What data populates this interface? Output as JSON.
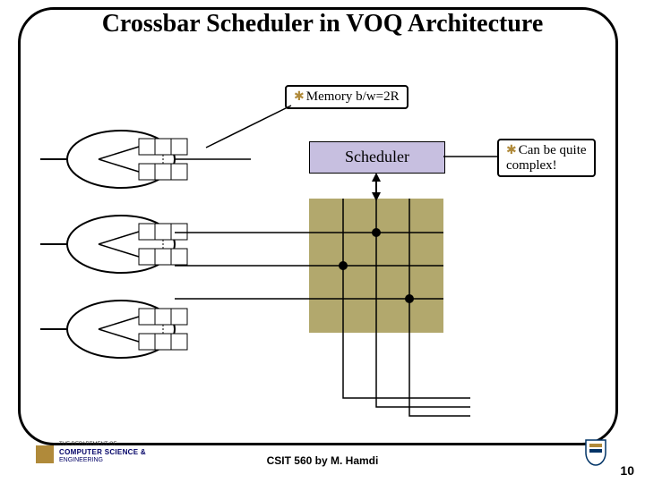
{
  "title": "Crossbar Scheduler in VOQ Architecture",
  "callouts": {
    "memory": "Memory b/w=2R",
    "complex_line1": "Can be quite",
    "complex_line2": "complex!"
  },
  "scheduler_label": "Scheduler",
  "footer": "CSIT 560 by M. Hamdi",
  "page_number": "10",
  "dept_logo": {
    "line1": "THE DEPARTMENT OF",
    "line2": "COMPUTER SCIENCE &",
    "line3": "ENGINEERING"
  }
}
